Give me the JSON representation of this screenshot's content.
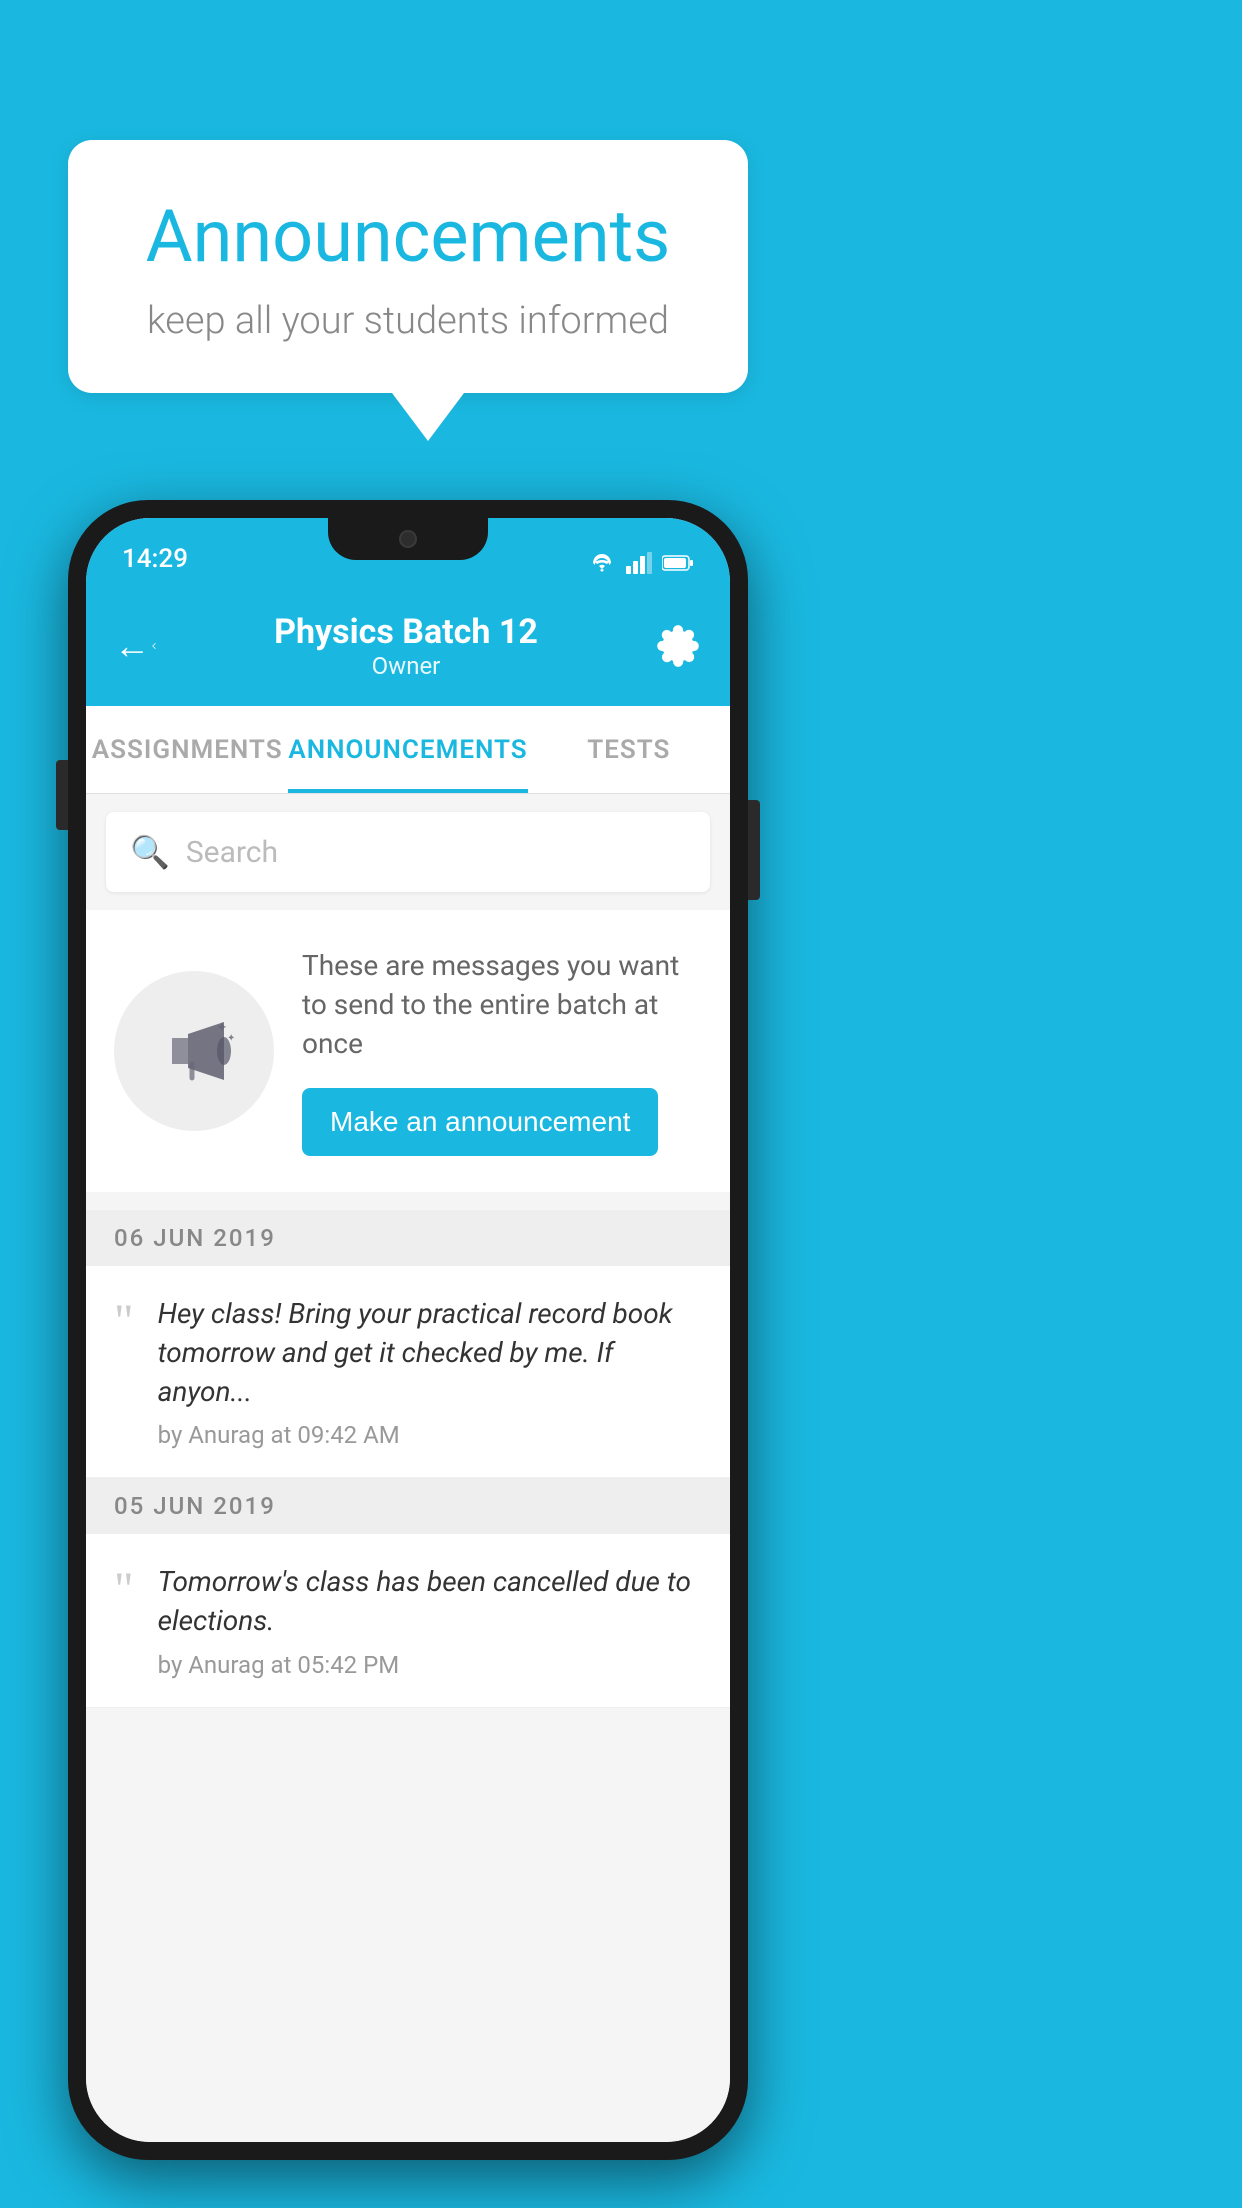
{
  "background_color": "#1ab8e0",
  "speech_bubble": {
    "title": "Announcements",
    "subtitle": "keep all your students informed"
  },
  "phone": {
    "status_bar": {
      "time": "14:29"
    },
    "app_bar": {
      "title": "Physics Batch 12",
      "subtitle": "Owner",
      "back_label": "←"
    },
    "tabs": [
      {
        "label": "ASSIGNMENTS",
        "active": false
      },
      {
        "label": "ANNOUNCEMENTS",
        "active": true
      },
      {
        "label": "TESTS",
        "active": false
      }
    ],
    "search": {
      "placeholder": "Search"
    },
    "empty_state": {
      "description": "These are messages you want to send to the entire batch at once",
      "button_label": "Make an announcement"
    },
    "announcements": [
      {
        "date": "06  JUN  2019",
        "message": "Hey class! Bring your practical record book tomorrow and get it checked by me. If anyon...",
        "meta": "by Anurag at 09:42 AM"
      },
      {
        "date": "05  JUN  2019",
        "message": "Tomorrow's class has been cancelled due to elections.",
        "meta": "by Anurag at 05:42 PM"
      }
    ]
  }
}
